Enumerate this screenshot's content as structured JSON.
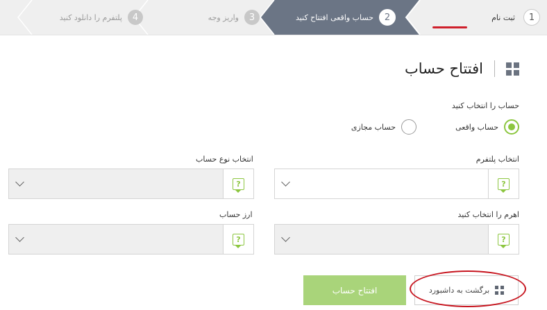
{
  "steps": [
    {
      "number": "1",
      "label": "ثبت نام"
    },
    {
      "number": "2",
      "label": "حساب واقعی افتتاح کنید"
    },
    {
      "number": "3",
      "label": "واریز وجه"
    },
    {
      "number": "4",
      "label": "پلتفرم را دانلود کنید"
    }
  ],
  "page": {
    "title": "افتتاح حساب"
  },
  "account_choice": {
    "label": "حساب را انتخاب کنید",
    "options": [
      {
        "label": "حساب واقعی",
        "selected": true
      },
      {
        "label": "حساب مجازی",
        "selected": false
      }
    ]
  },
  "fields": {
    "platform": {
      "label": "انتخاب پلتفرم",
      "value": "",
      "help": "?"
    },
    "account_type": {
      "label": "انتخاب نوع حساب",
      "value": "",
      "help": "?"
    },
    "leverage": {
      "label": "اهرم را انتخاب کنید",
      "value": "",
      "help": "?"
    },
    "currency": {
      "label": "ارز حساب",
      "value": "",
      "help": "?"
    }
  },
  "buttons": {
    "open_account": "افتتاح حساب",
    "back_to_dashboard": "برگشت به داشبورد"
  },
  "colors": {
    "active_step_bg": "#6b7585",
    "accent_green": "#8cc63f",
    "button_green": "#a9d47a",
    "annotation_red": "#cf1f2b"
  },
  "icons": {
    "title": "grid-icon",
    "help": "question-speech-icon",
    "dropdown": "chevron-down-icon",
    "back": "grid-icon"
  }
}
